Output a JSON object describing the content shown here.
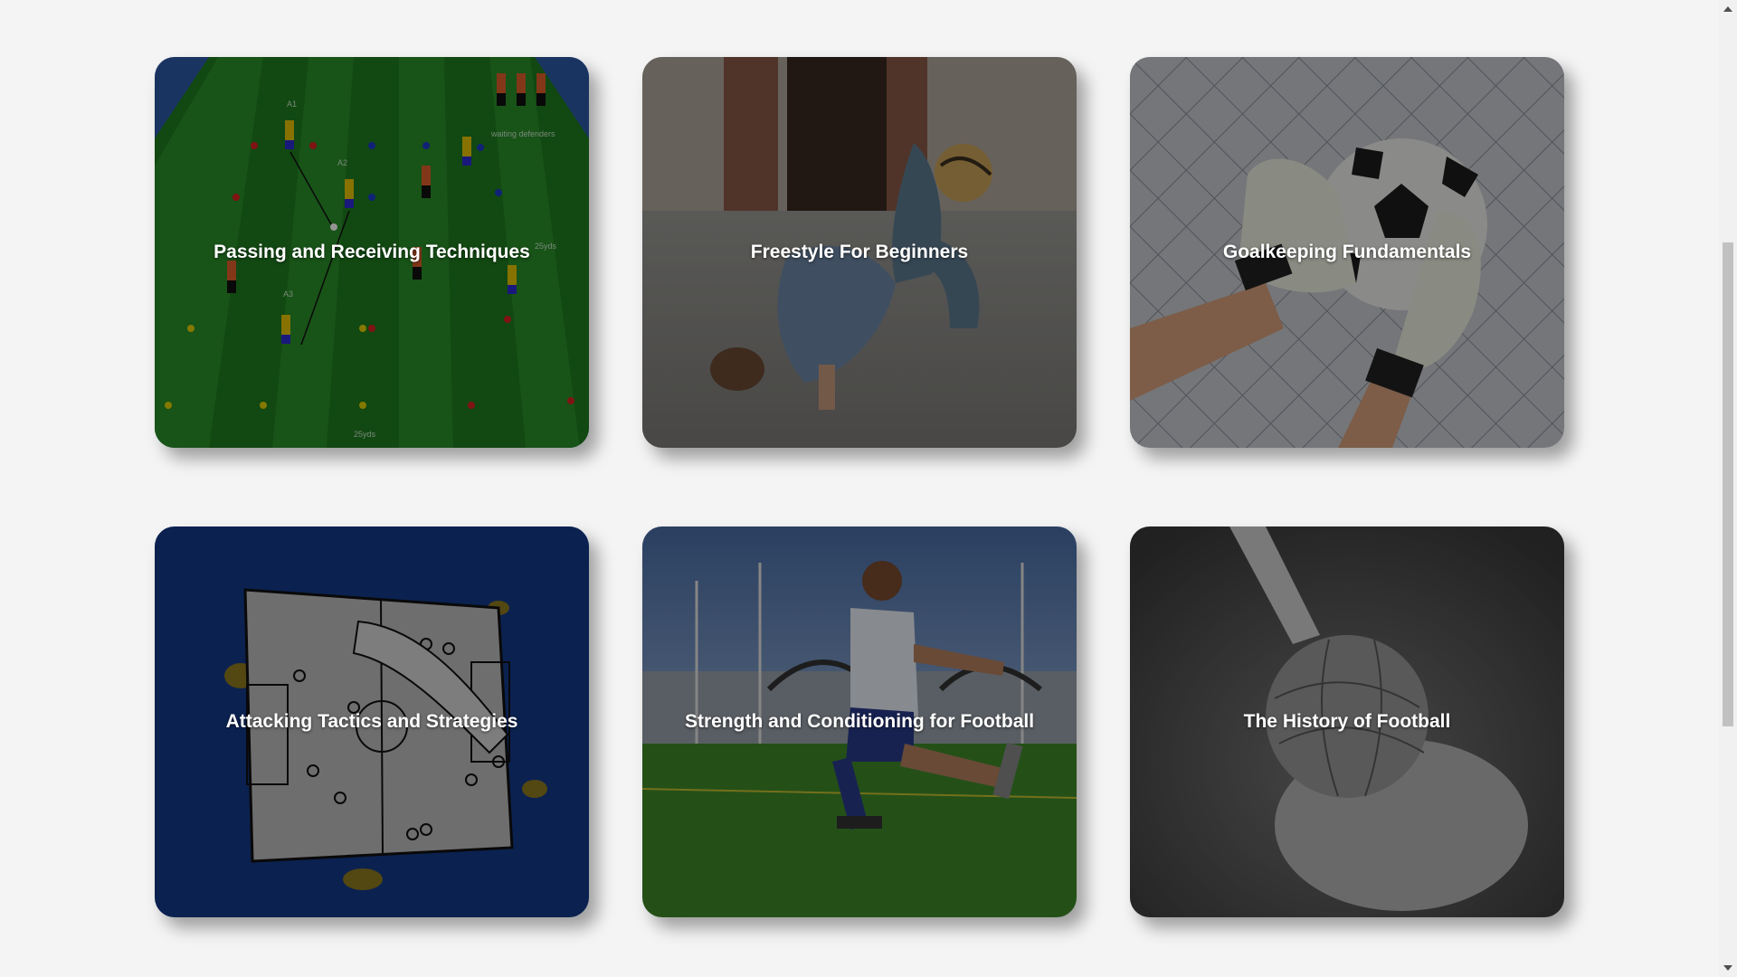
{
  "courses": [
    {
      "title": "Passing and Receiving Techniques",
      "image": "passing-drill-diagram"
    },
    {
      "title": "Freestyle For Beginners",
      "image": "freestyle-player-photo"
    },
    {
      "title": "Goalkeeping Fundamentals",
      "image": "goalkeeper-catch-photo"
    },
    {
      "title": "Attacking Tactics and Strategies",
      "image": "tactics-board-sketch"
    },
    {
      "title": "Strength and Conditioning for Football",
      "image": "player-squat-photo"
    },
    {
      "title": "The History of Football",
      "image": "vintage-ball-photo"
    }
  ],
  "drill_labels": {
    "waiting": "waiting defenders",
    "yards_side": "25yds",
    "yards_bottom": "25yds",
    "a1": "A1",
    "a2": "A2",
    "a3": "A3"
  },
  "colors": {
    "page_background": "#f4f4f4",
    "title_text": "#ffffff"
  }
}
